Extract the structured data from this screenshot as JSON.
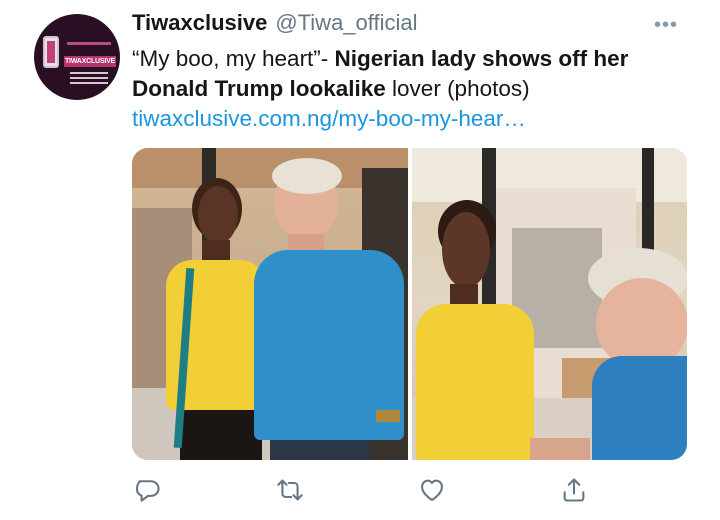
{
  "tweet": {
    "author_name": "Tiwaxclusive",
    "author_handle": "@Tiwa_official",
    "more_glyph": "•••",
    "avatar_brand": "TIWAXCLUSIVE",
    "text_quote": "“My boo, my heart”- ",
    "text_bold": "Nigerian lady shows off her Donald Trump lookalike",
    "text_rest": " lover (photos)",
    "link": "tiwaxclusive.com.ng/my-boo-my-hear…"
  },
  "actions": {
    "reply_icon": "reply-icon",
    "retweet_icon": "retweet-icon",
    "like_icon": "heart-icon",
    "share_icon": "share-icon"
  },
  "colors": {
    "text": "#14171a",
    "secondary": "#657786",
    "link": "#1b95e0",
    "icon": "#657786"
  }
}
